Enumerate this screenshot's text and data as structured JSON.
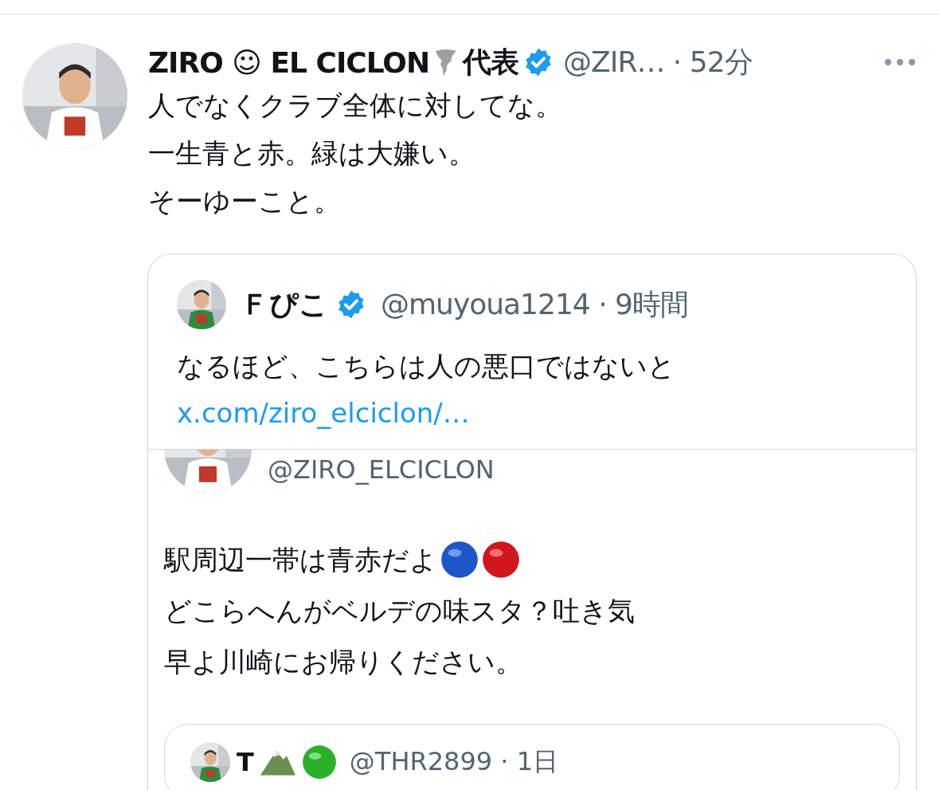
{
  "tweet": {
    "author": {
      "name": "ZIRO ☺ EL CICLON",
      "title": "代表",
      "verified": true,
      "meta": "@ZIR… · 52分"
    },
    "text_lines": [
      "人でなくクラブ全体に対してな。",
      "一生青と赤。緑は大嫌い。",
      "そーゆーこと。"
    ],
    "quote": {
      "author": {
        "name": "Ｆぴこ",
        "verified": true,
        "meta": "@muyoua1214 · 9時間"
      },
      "text": "なるほど、こちらは人の悪口ではないと",
      "link": "x.com/ziro_elciclon/…",
      "embedded": {
        "handle": "@ZIRO_ELCICLON",
        "text_lines": [
          "駅周辺一帯は青赤だよ",
          "どこらへんがベルデの味スタ？吐き気",
          "早よ川崎にお帰りください。"
        ],
        "quote": {
          "name": "T",
          "meta": "@THR2899 · 1日"
        }
      }
    }
  }
}
